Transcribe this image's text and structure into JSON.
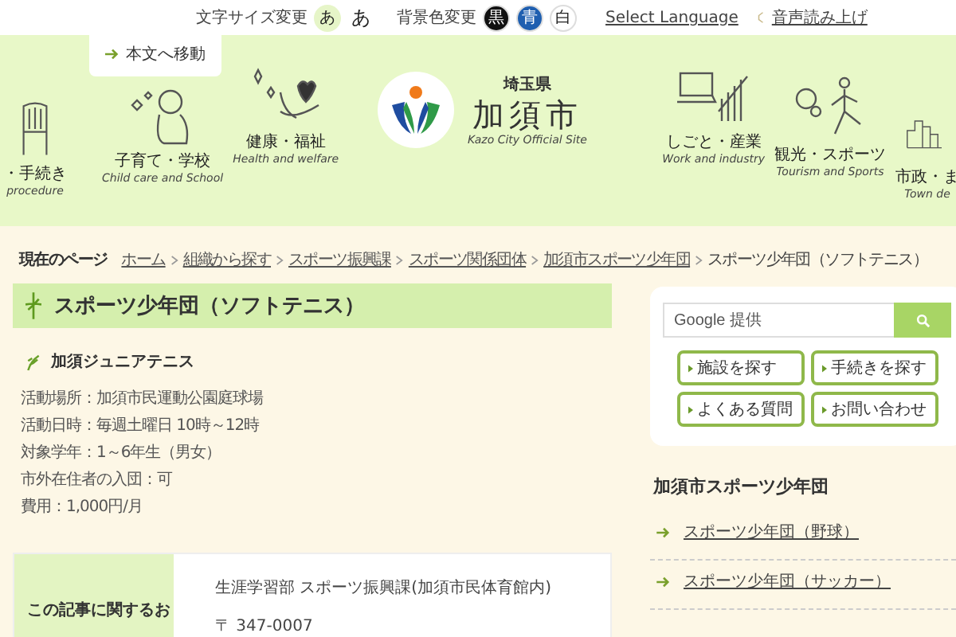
{
  "top_bar": {
    "font_size_label": "文字サイズ変更",
    "font_sizes": [
      {
        "label": "あ",
        "selected": true
      },
      {
        "label": "あ",
        "selected": false
      }
    ],
    "bg_color_label": "背景色変更",
    "bg_colors": [
      {
        "label": "黒",
        "color": "#111111"
      },
      {
        "label": "青",
        "color": "#1f5fb0"
      },
      {
        "label": "白",
        "color": "#ffffff"
      }
    ],
    "language": "Select Language",
    "read_aloud": "音声読み上げ"
  },
  "skip_link": "本文へ移動",
  "header": {
    "prefecture": "埼玉県",
    "city": "加須市",
    "tagline": "Kazo City Official Site",
    "nav_left": [
      {
        "kind": "chair",
        "label": "・手続き",
        "sub": "procedure"
      },
      {
        "kind": "baby",
        "label": "子育て・学校",
        "sub": "Child care and School"
      },
      {
        "kind": "heart",
        "label": "健康・福祉",
        "sub": "Health and welfare"
      }
    ],
    "nav_right": [
      {
        "kind": "laptop",
        "label": "しごと・産業",
        "sub": "Work and industry"
      },
      {
        "kind": "runner",
        "label": "観光・スポーツ",
        "sub": "Tourism and Sports"
      },
      {
        "kind": "city",
        "label": "市政・ま",
        "sub": "Town de"
      }
    ]
  },
  "breadcrumb": {
    "label": "現在のページ",
    "links": [
      "ホーム",
      "組織から探す",
      "スポーツ振興課",
      "スポーツ関係団体",
      "加須市スポーツ少年団"
    ],
    "current": "スポーツ少年団（ソフトテニス）"
  },
  "page_title": "スポーツ少年団（ソフトテニス）",
  "section_title": "加須ジュニアテニス",
  "details": [
    "活動場所：加須市民運動公園庭球場",
    "活動日時：毎週土曜日 10時～12時",
    "対象学年：1～6年生（男女）",
    "市外在住者の入団：可",
    "費用：1,000円/月"
  ],
  "contact": {
    "heading": "この記事に関するお",
    "department": "生涯学習部 スポーツ振興課(加須市民体育館内)",
    "postal": "〒 347-0007"
  },
  "search": {
    "placeholder": "Google 提供"
  },
  "quick_links": [
    "施設を探す",
    "手続きを探す",
    "よくある質問",
    "お問い合わせ"
  ],
  "sidebar": {
    "title": "加須市スポーツ少年団",
    "links": [
      "スポーツ少年団（野球）",
      "スポーツ少年団（サッカー）"
    ]
  }
}
